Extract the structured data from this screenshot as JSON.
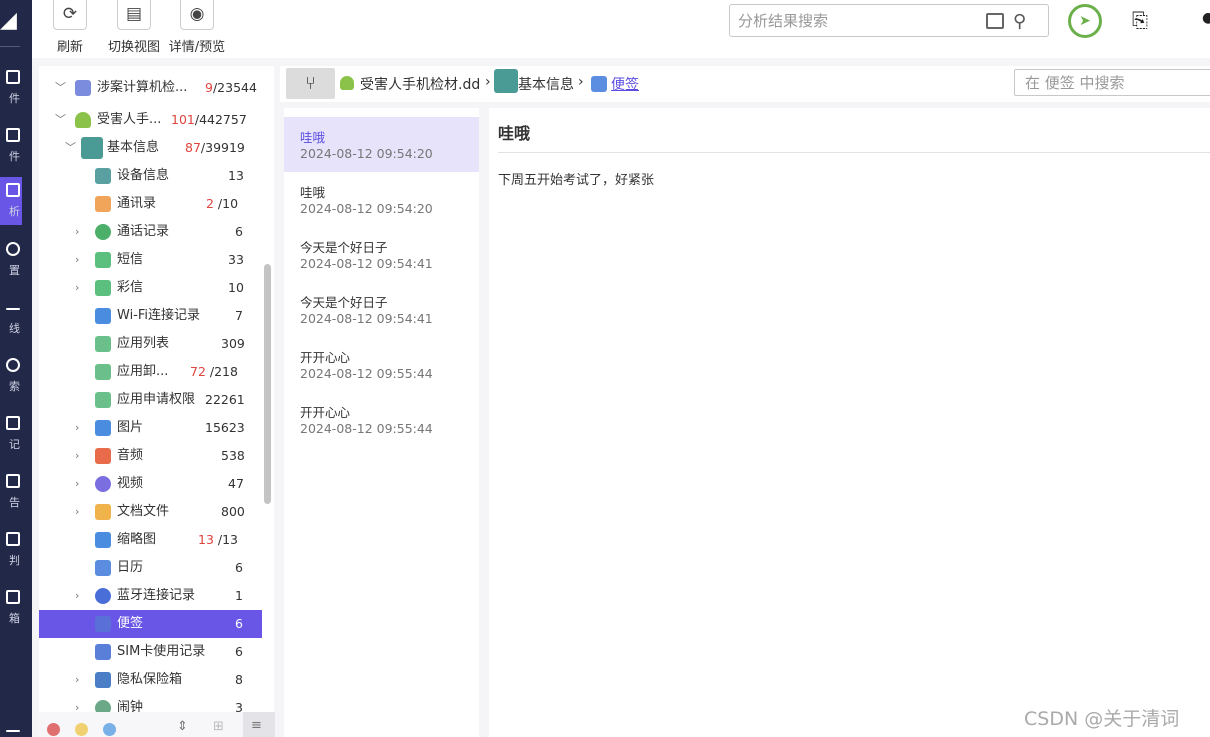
{
  "toolbar": {
    "refresh_label": "刷新",
    "switch_view_label": "切换视图",
    "detail_preview_label": "详情/预览",
    "search_placeholder": "分析结果搜索"
  },
  "rail": [
    {
      "label": "件",
      "active": false
    },
    {
      "label": "件",
      "active": false
    },
    {
      "label": "析",
      "active": true
    },
    {
      "label": "置",
      "active": false
    },
    {
      "label": "线",
      "active": false
    },
    {
      "label": "索",
      "active": false
    },
    {
      "label": "记",
      "active": false
    },
    {
      "label": "告",
      "active": false
    },
    {
      "label": "判",
      "active": false
    },
    {
      "label": "箱",
      "active": false
    }
  ],
  "tree": [
    {
      "name": "涉案计算机检...",
      "count_red": "9",
      "count": "/23544"
    },
    {
      "name": "受害人手...",
      "count_red": "101",
      "count": "/442757"
    },
    {
      "name": "基本信息",
      "count_red": "87",
      "count": "/39919"
    },
    {
      "name": "设备信息",
      "count_red": "",
      "count": "13"
    },
    {
      "name": "通讯录",
      "count_red": "2",
      "count": " /10"
    },
    {
      "name": "通话记录",
      "count_red": "",
      "count": "6"
    },
    {
      "name": "短信",
      "count_red": "",
      "count": "33"
    },
    {
      "name": "彩信",
      "count_red": "",
      "count": "10"
    },
    {
      "name": "Wi-Fi连接记录",
      "count_red": "",
      "count": "7"
    },
    {
      "name": "应用列表",
      "count_red": "",
      "count": "309"
    },
    {
      "name": "应用卸...",
      "count_red": "72",
      "count": " /218"
    },
    {
      "name": "应用申请权限",
      "count_red": "",
      "count": "22261"
    },
    {
      "name": "图片",
      "count_red": "",
      "count": "15623"
    },
    {
      "name": "音频",
      "count_red": "",
      "count": "538"
    },
    {
      "name": "视频",
      "count_red": "",
      "count": "47"
    },
    {
      "name": "文档文件",
      "count_red": "",
      "count": "800"
    },
    {
      "name": "缩略图",
      "count_red": "13",
      "count": " /13"
    },
    {
      "name": "日历",
      "count_red": "",
      "count": "6"
    },
    {
      "name": "蓝牙连接记录",
      "count_red": "",
      "count": "1"
    },
    {
      "name": "便签",
      "count_red": "",
      "count": "6"
    },
    {
      "name": "SIM卡使用记录",
      "count_red": "",
      "count": "6"
    },
    {
      "name": "隐私保险箱",
      "count_red": "",
      "count": "8"
    },
    {
      "name": "闹钟",
      "count_red": "",
      "count": "3"
    }
  ],
  "breadcrumb": {
    "items": [
      "受害人手机检材.dd",
      "基本信息",
      "便签"
    ],
    "search_placeholder": "在 便签 中搜索"
  },
  "notes": [
    {
      "title": "哇哦",
      "date": "2024-08-12 09:54:20"
    },
    {
      "title": "哇哦",
      "date": "2024-08-12 09:54:20"
    },
    {
      "title": "今天是个好日子",
      "date": "2024-08-12 09:54:41"
    },
    {
      "title": "今天是个好日子",
      "date": "2024-08-12 09:54:41"
    },
    {
      "title": "开开心心",
      "date": "2024-08-12 09:55:44"
    },
    {
      "title": "开开心心",
      "date": "2024-08-12 09:55:44"
    }
  ],
  "detail": {
    "title": "哇哦",
    "body": "下周五开始考试了，好紧张"
  },
  "watermark": "CSDN @关于清词"
}
